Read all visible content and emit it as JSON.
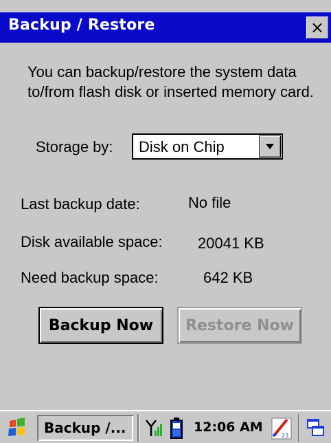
{
  "window": {
    "title": "Backup / Restore",
    "close_label": "×"
  },
  "content": {
    "description": "You can backup/restore the system data to/from flash disk or inserted memory card.",
    "storage_label": "Storage by:",
    "storage_value": "Disk on Chip",
    "info": [
      {
        "label": "Last backup date:",
        "value": "No file"
      },
      {
        "label": "Disk available space:",
        "value": "20041 KB"
      },
      {
        "label": "Need backup space:",
        "value": "642 KB"
      }
    ],
    "backup_button": "Backup Now",
    "restore_button": "Restore Now"
  },
  "taskbar": {
    "task_label": "Backup /...",
    "clock": "12:06 AM",
    "icons": [
      "start-icon",
      "signal-icon",
      "battery-icon",
      "input-panel-icon",
      "windows-icon"
    ]
  },
  "colors": {
    "titlebar": "#0a0acb",
    "face": "#c8c8c8",
    "disabled_text": "#8f8f8f"
  }
}
